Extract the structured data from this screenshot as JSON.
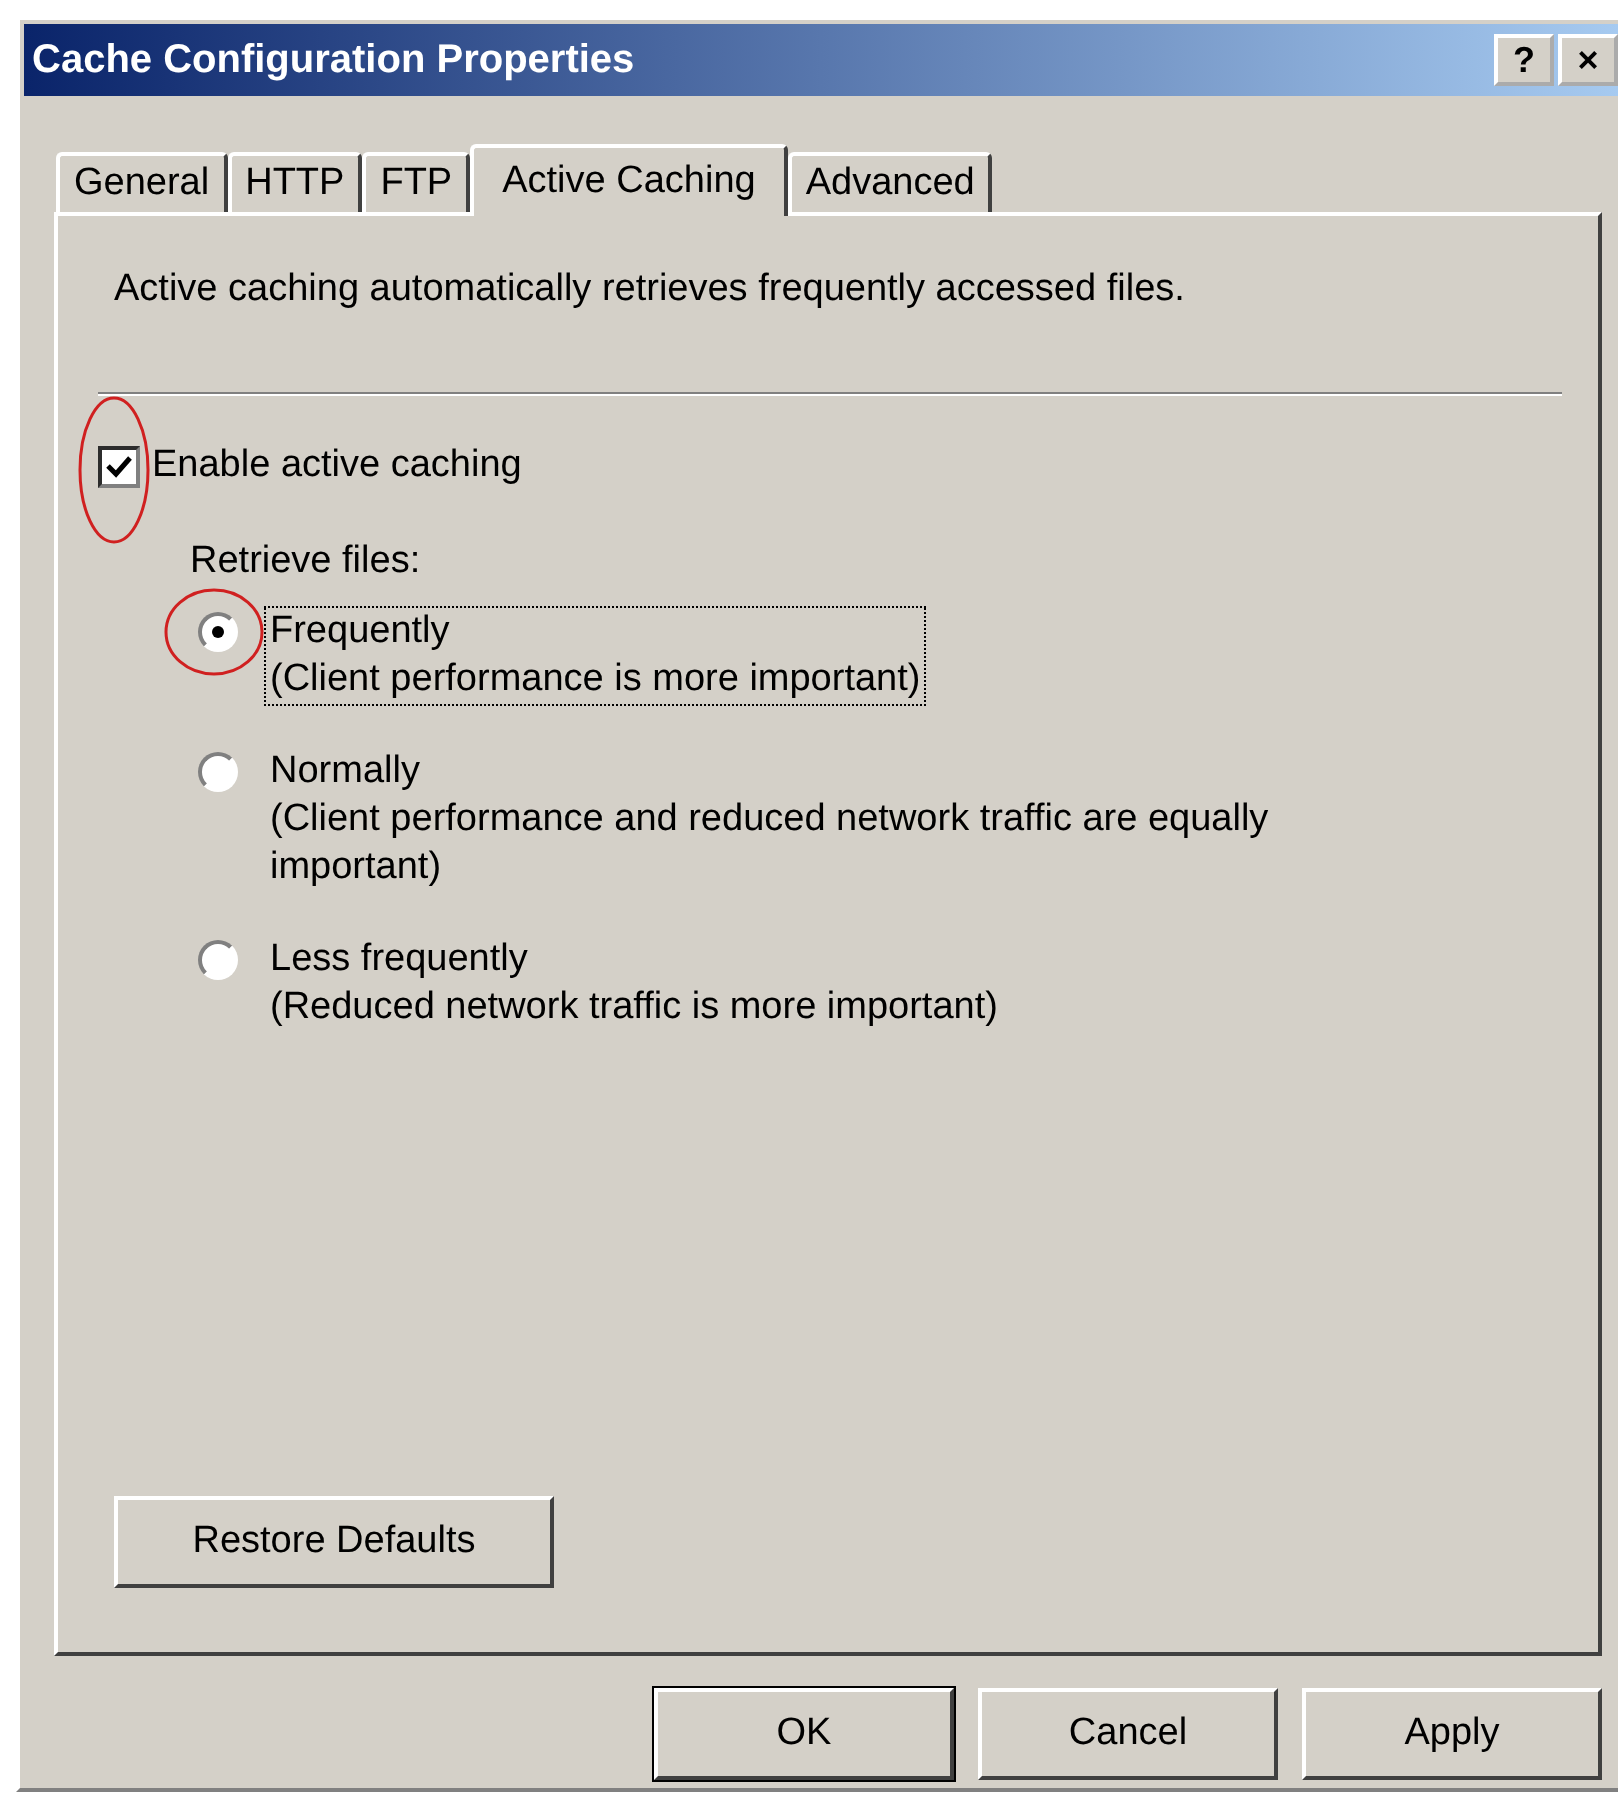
{
  "window": {
    "title": "Cache Configuration Properties",
    "title_buttons": [
      "?",
      "×"
    ]
  },
  "tabs": [
    {
      "label": "General",
      "selected": false
    },
    {
      "label": "HTTP",
      "selected": false
    },
    {
      "label": "FTP",
      "selected": false
    },
    {
      "label": "Active Caching",
      "selected": true
    },
    {
      "label": "Advanced",
      "selected": false
    }
  ],
  "description": "Active caching automatically retrieves frequently accessed files.",
  "enable_checkbox": {
    "label": "Enable active caching",
    "checked": true,
    "highlighted": true
  },
  "retrieve_label": "Retrieve files:",
  "options": [
    {
      "label": "Frequently",
      "detail": "(Client performance is more important)",
      "selected": true,
      "focused": true,
      "highlighted": true
    },
    {
      "label": "Normally",
      "detail": "(Client performance and reduced network traffic are equally important)",
      "selected": false,
      "focused": false,
      "highlighted": false
    },
    {
      "label": "Less frequently",
      "detail": "(Reduced network traffic is more important)",
      "selected": false,
      "focused": false,
      "highlighted": false
    }
  ],
  "restore_button": "Restore Defaults",
  "buttons": [
    {
      "label": "OK",
      "default": true
    },
    {
      "label": "Cancel",
      "default": false
    },
    {
      "label": "Apply",
      "default": false
    }
  ]
}
